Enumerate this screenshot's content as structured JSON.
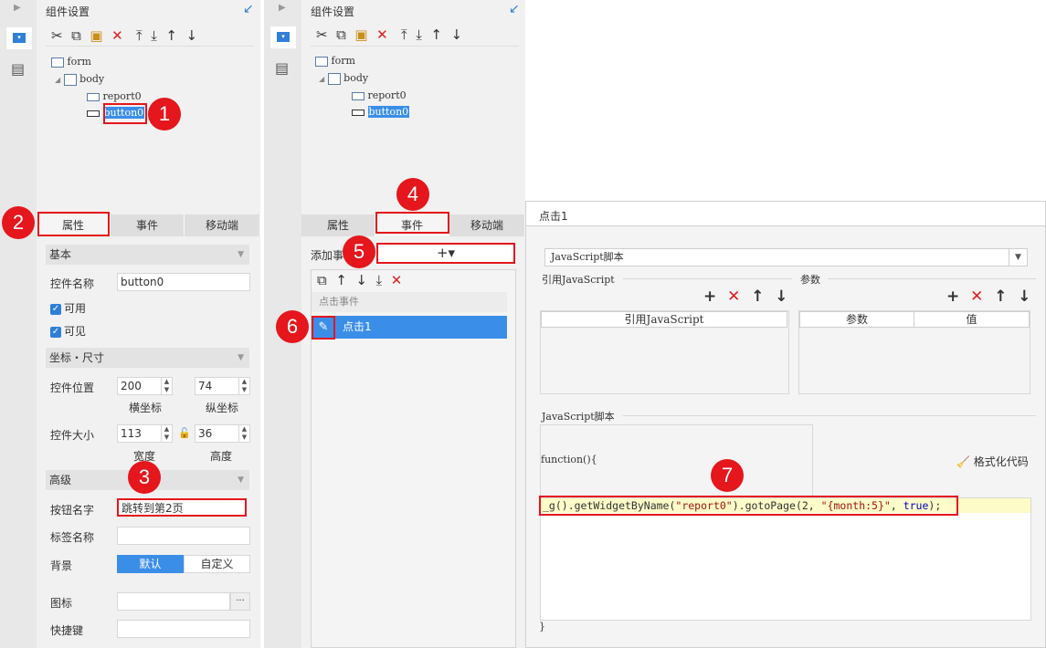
{
  "left_panel": {
    "title": "组件设置",
    "tree": {
      "form": "form",
      "body": "body",
      "report": "report0",
      "button": "button0"
    },
    "tabs": [
      "属性",
      "事件",
      "移动端"
    ],
    "basic_section": "基本",
    "widget_name_label": "控件名称",
    "widget_name_value": "button0",
    "enabled_label": "可用",
    "visible_label": "可见",
    "coord_section": "坐标・尺寸",
    "position_label": "控件位置",
    "pos_x": "200",
    "pos_y": "74",
    "x_label": "横坐标",
    "y_label": "纵坐标",
    "size_label": "控件大小",
    "width": "113",
    "height": "36",
    "w_label": "宽度",
    "h_label": "高度",
    "advanced_section": "高级",
    "button_name_label": "按钮名字",
    "button_name_value": "跳转到第2页",
    "tag_name_label": "标签名称",
    "bg_label": "背景",
    "bg_default": "默认",
    "bg_custom": "自定义",
    "icon_label": "图标",
    "icon_btn": "···",
    "shortcut_label": "快捷键"
  },
  "mid_panel": {
    "title": "组件设置",
    "tree": {
      "form": "form",
      "body": "body",
      "report": "report0",
      "button": "button0"
    },
    "tabs": [
      "属性",
      "事件",
      "移动端"
    ],
    "add_event_label": "添加事",
    "add_icon": "+▾",
    "event_group": "点击事件",
    "event_item": "点击1"
  },
  "dialog": {
    "title": "点击1",
    "select_value": "JavaScript脚本",
    "ref_js_label": "引用JavaScript",
    "params_label": "参数",
    "ref_js_col": "引用JavaScript",
    "param_col": "参数",
    "value_col": "值",
    "script_section": "JavaScript脚本",
    "func_header": "function(){",
    "format_btn": "格式化代码",
    "code_prefix": "_g().getWidgetByName(",
    "code_str1": "\"report0\"",
    "code_mid": ").gotoPage(2, ",
    "code_str2": "\"{month:5}\"",
    "code_sep": ", ",
    "code_kw": "true",
    "code_end": ");",
    "func_footer": "}"
  },
  "markers": [
    "1",
    "2",
    "3",
    "4",
    "5",
    "6",
    "7"
  ],
  "colors": {
    "accent": "#2f7fd8",
    "marker": "#e5161c",
    "selected": "#3b8ee8"
  }
}
